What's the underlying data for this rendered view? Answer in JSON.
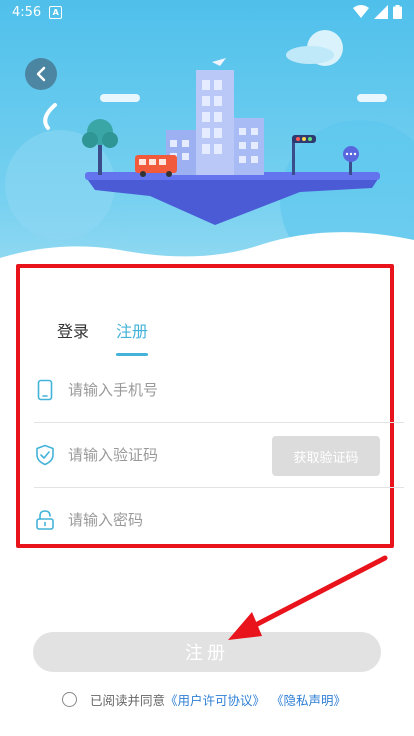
{
  "status_bar": {
    "time": "4:56",
    "app_icon_letter": "A"
  },
  "tabs": {
    "login": "登录",
    "register": "注册"
  },
  "form": {
    "phone_placeholder": "请输入手机号",
    "code_placeholder": "请输入验证码",
    "password_placeholder": "请输入密码",
    "get_code_label": "获取验证码"
  },
  "submit_label": "注册",
  "agreement": {
    "prefix": "已阅读并同意",
    "user_agreement": "《用户许可协议》",
    "privacy": "《隐私声明》"
  },
  "colors": {
    "accent": "#44b3d9",
    "annotation_red": "#e8131b",
    "link": "#2f7fd4"
  }
}
